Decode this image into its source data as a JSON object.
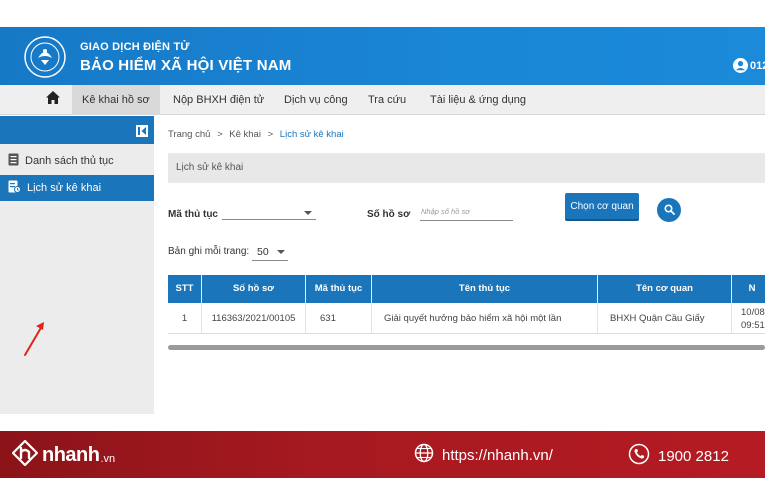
{
  "header": {
    "org_line1": "GIAO DỊCH ĐIỆN TỬ",
    "org_line2": "BẢO HIỂM XÃ HỘI VIỆT NAM",
    "user_text": "012",
    "brand_color": "#1b75bb"
  },
  "nav": {
    "items": [
      {
        "label": "Kê khai hồ sơ",
        "active": true
      },
      {
        "label": "Nộp BHXH điện tử"
      },
      {
        "label": "Dịch vụ công"
      },
      {
        "label": "Tra cứu"
      },
      {
        "label": "Tài liệu & ứng dụng"
      }
    ]
  },
  "sidebar": {
    "items": [
      {
        "label": "Danh sách thủ tục",
        "icon": "document-list-icon"
      },
      {
        "label": "Lịch sử kê khai",
        "icon": "history-document-icon",
        "active": true
      }
    ]
  },
  "breadcrumb": {
    "home": "Trang chủ",
    "sep": ">",
    "level1": "Kê khai",
    "current": "Lịch sử kê khai"
  },
  "section": {
    "title": "Lịch sử kê khai"
  },
  "filters": {
    "procedure_label": "Mã thủ tục",
    "procedure_value": "",
    "file_number_label": "Số hồ sơ",
    "file_number_placeholder": "Nhập số hồ sơ",
    "choose_agency_label": "Chọn cơ quan"
  },
  "paging": {
    "label": "Bản ghi mỗi trang:",
    "value": "50"
  },
  "table": {
    "columns": [
      "STT",
      "Số hồ sơ",
      "Mã thủ tục",
      "Tên thủ tục",
      "Tên cơ quan",
      "N"
    ],
    "rows": [
      {
        "stt": "1",
        "file_number": "116363/2021/00105",
        "procedure_code": "631",
        "procedure_name": "Giải quyết hưởng bảo hiểm xã hội một lần",
        "agency": "BHXH Quận Cầu Giấy",
        "date": "10/08",
        "time": "09:51"
      }
    ]
  },
  "banner": {
    "brand": "nhanh",
    "brand_tld": ".vn",
    "website": "https://nhanh.vn/",
    "hotline": "1900 2812",
    "color": "#a51920"
  }
}
